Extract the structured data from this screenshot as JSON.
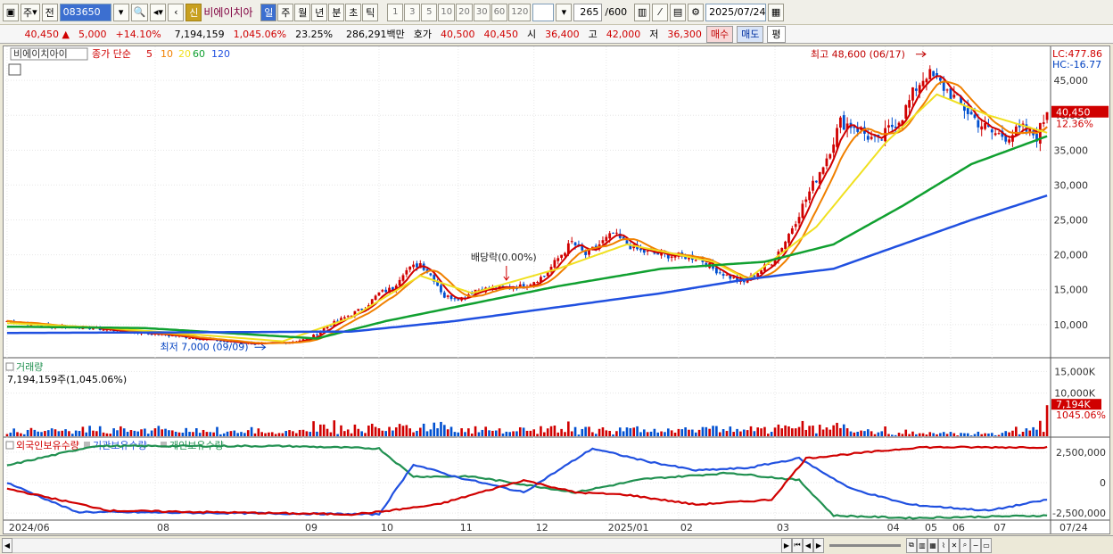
{
  "toolbar": {
    "market_type": "주",
    "prev_label": "전",
    "stock_code": "083650",
    "stock_name": "비에이치아",
    "credit_badge": "신",
    "periods": [
      "일",
      "주",
      "월",
      "년",
      "분",
      "초",
      "틱"
    ],
    "active_period": "일",
    "intervals": [
      "1",
      "3",
      "5",
      "10",
      "20",
      "30",
      "60",
      "120"
    ],
    "count": "265",
    "count_max": "/600",
    "date": "2025/07/24"
  },
  "quote": {
    "price": "40,450",
    "change": "5,000",
    "change_pct": "+14.10%",
    "volume": "7,194,159",
    "volume_pct": "1,045.06%",
    "turnover": "23.25%",
    "amount": "286,291백만",
    "bid_label": "호가",
    "bid": "40,500",
    "ask": "40,450",
    "open_label": "시",
    "open": "36,400",
    "high_label": "고",
    "high": "42,000",
    "low_label": "저",
    "low": "36,300",
    "buy_button": "매수",
    "sell_button": "매도",
    "eval_button": "평"
  },
  "chart_data": {
    "type": "candlestick",
    "legend": {
      "name": "비에이치아이",
      "series_label": "종가 단순",
      "ma_periods": [
        "5",
        "10",
        "20",
        "60",
        "120"
      ],
      "ma_colors": [
        "#d00000",
        "#f08000",
        "#f0e020",
        "#10a030",
        "#2050e0"
      ]
    },
    "right_labels": {
      "lc": "LC:477.86",
      "hc": "HC:-16.77"
    },
    "price_axis": [
      "45,000",
      "40,000",
      "35,000",
      "30,000",
      "25,000",
      "20,000",
      "15,000",
      "10,000"
    ],
    "price_range": [
      5500,
      48600
    ],
    "current_price_label": "40,450",
    "current_change_label": "12.36%",
    "annotations": {
      "high": "최고 48,600 (06/17)",
      "low": "최저 7,000 (09/09)",
      "dividend": "배당락(0.00%)"
    },
    "close_path": [
      [
        0,
        10500
      ],
      [
        12,
        9800
      ],
      [
        20,
        9700
      ],
      [
        30,
        9200
      ],
      [
        40,
        8800
      ],
      [
        52,
        8200
      ],
      [
        65,
        7500
      ],
      [
        75,
        7200
      ],
      [
        82,
        7500
      ],
      [
        88,
        8000
      ],
      [
        92,
        9500
      ],
      [
        98,
        11000
      ],
      [
        104,
        12500
      ],
      [
        108,
        14500
      ],
      [
        112,
        15200
      ],
      [
        115,
        17500
      ],
      [
        120,
        18800
      ],
      [
        124,
        16500
      ],
      [
        127,
        14000
      ],
      [
        132,
        13800
      ],
      [
        136,
        15000
      ],
      [
        142,
        15200
      ],
      [
        150,
        15500
      ],
      [
        156,
        17000
      ],
      [
        160,
        19500
      ],
      [
        164,
        21800
      ],
      [
        168,
        20000
      ],
      [
        172,
        21500
      ],
      [
        176,
        23000
      ],
      [
        180,
        21500
      ],
      [
        184,
        20500
      ],
      [
        190,
        20000
      ],
      [
        196,
        19800
      ],
      [
        201,
        19500
      ],
      [
        205,
        18000
      ],
      [
        210,
        16800
      ],
      [
        214,
        16000
      ],
      [
        218,
        17500
      ],
      [
        222,
        19000
      ],
      [
        226,
        22000
      ],
      [
        230,
        26000
      ],
      [
        234,
        30000
      ],
      [
        238,
        34000
      ],
      [
        242,
        39000
      ],
      [
        246,
        38500
      ],
      [
        250,
        37000
      ],
      [
        253,
        36000
      ],
      [
        256,
        38000
      ],
      [
        260,
        40000
      ],
      [
        264,
        44000
      ],
      [
        267,
        46000
      ],
      [
        270,
        45000
      ],
      [
        274,
        43000
      ],
      [
        278,
        41000
      ],
      [
        282,
        39000
      ],
      [
        286,
        37500
      ],
      [
        290,
        37000
      ],
      [
        295,
        38000
      ],
      [
        299,
        37000
      ],
      [
        302,
        40450
      ]
    ],
    "ma_anchors": {
      "20": [
        [
          0,
          10200
        ],
        [
          30,
          9500
        ],
        [
          80,
          7600
        ],
        [
          100,
          11000
        ],
        [
          120,
          17000
        ],
        [
          135,
          14500
        ],
        [
          160,
          18000
        ],
        [
          180,
          21500
        ],
        [
          205,
          19000
        ],
        [
          215,
          16500
        ],
        [
          235,
          24000
        ],
        [
          255,
          36000
        ],
        [
          270,
          43000
        ],
        [
          285,
          40000
        ],
        [
          302,
          37500
        ]
      ],
      "60": [
        [
          0,
          9700
        ],
        [
          40,
          9500
        ],
        [
          90,
          8000
        ],
        [
          110,
          10500
        ],
        [
          135,
          13000
        ],
        [
          160,
          15500
        ],
        [
          190,
          18000
        ],
        [
          220,
          19000
        ],
        [
          240,
          21500
        ],
        [
          260,
          27000
        ],
        [
          280,
          33000
        ],
        [
          302,
          37000
        ]
      ],
      "120": [
        [
          0,
          8800
        ],
        [
          60,
          8900
        ],
        [
          100,
          9000
        ],
        [
          130,
          10500
        ],
        [
          160,
          12500
        ],
        [
          190,
          14500
        ],
        [
          215,
          16500
        ],
        [
          240,
          18000
        ],
        [
          260,
          21500
        ],
        [
          280,
          25000
        ],
        [
          302,
          28500
        ]
      ]
    },
    "volume_label": "거래량",
    "volume_value_label": "7,194,159주(1,045.06%)",
    "volume_axis": [
      "15,000K",
      "10,000K"
    ],
    "volume_current_label": "7,194K",
    "volume_current_pct": "1045.06%",
    "holdings_legend": [
      "외국인보유수량",
      "기관보유수량",
      "개인보유수량"
    ],
    "holdings_colors": [
      "#d00000",
      "#2050e0",
      "#209050"
    ],
    "holdings_axis": [
      "2,500,000",
      "0",
      "-2,500,000"
    ],
    "x_axis_labels": [
      "2024/06",
      "08",
      "09",
      "10",
      "11",
      "12",
      "2025/01",
      "02",
      "03",
      "04",
      "05",
      "06",
      "07"
    ],
    "x_axis_end": "07/24"
  }
}
